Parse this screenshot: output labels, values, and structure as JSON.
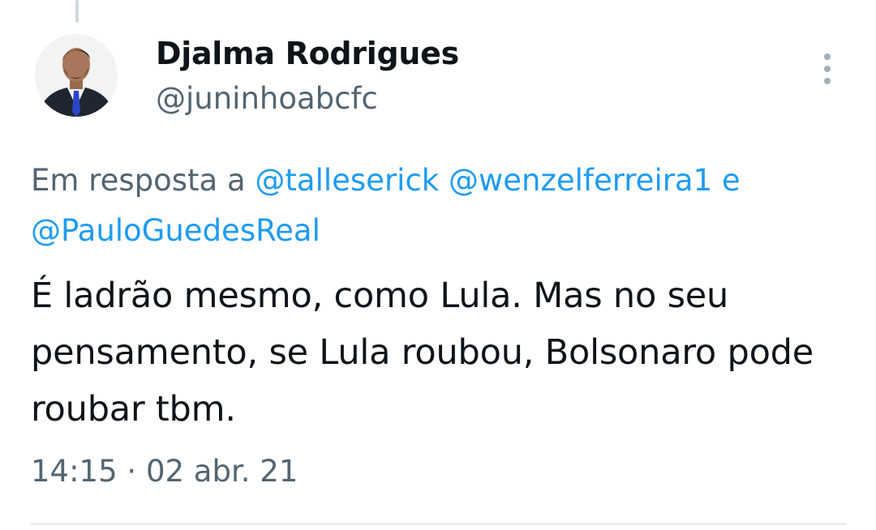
{
  "author": {
    "name": "Djalma Rodrigues",
    "handle": "@juninhoabcfc"
  },
  "reply": {
    "prefix": "Em resposta a",
    "mentions": [
      "@talleserick",
      "@wenzelferreira1",
      "@PauloGuedesReal"
    ],
    "conjunction": "e"
  },
  "tweet": {
    "text": "É ladrão mesmo, como Lula. Mas no seu pensamento, se Lula roubou, Bolsonaro pode roubar tbm.",
    "time": "14:15",
    "separator": "·",
    "date": "02 abr. 21"
  },
  "icons": {
    "more": "more-vertical-icon",
    "avatar": "user-photo"
  },
  "colors": {
    "text": "#0f1419",
    "secondary": "#536471",
    "link": "#1d9bf0",
    "divider": "#cfd9de"
  }
}
